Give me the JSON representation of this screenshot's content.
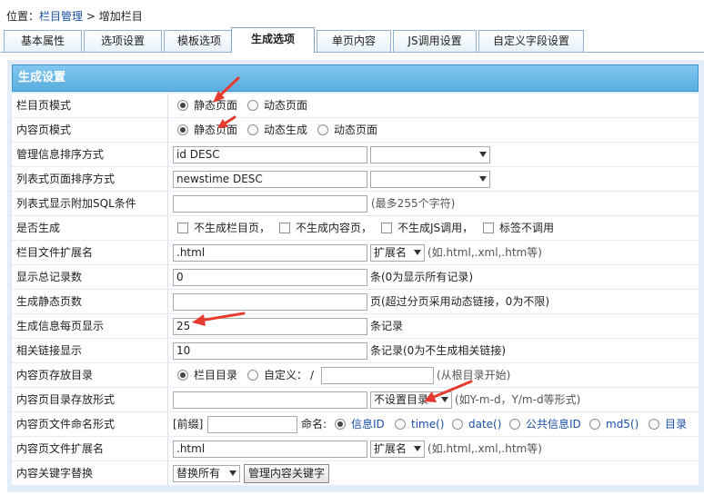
{
  "breadcrumb": {
    "prefix": "位置：",
    "link": "栏目管理",
    "sep": " > ",
    "current": "增加栏目"
  },
  "tabs": [
    "基本属性",
    "选项设置",
    "模板选项",
    "生成选项",
    "单页内容",
    "JS调用设置",
    "自定义字段设置"
  ],
  "active_tab": "生成选项",
  "panel_title": "生成设置",
  "colors": {
    "header": "#5aaede",
    "arrow": "#e53c2f",
    "link": "#1a4fa3"
  },
  "rows": {
    "list_mode": {
      "label": "栏目页模式",
      "opt1": "静态页面",
      "opt2": "动态页面"
    },
    "content_mode": {
      "label": "内容页模式",
      "opt1": "静态页面",
      "opt2": "动态生成",
      "opt3": "动态页面"
    },
    "admin_sort": {
      "label": "管理信息排序方式",
      "value": "id DESC",
      "select": ""
    },
    "list_sort": {
      "label": "列表式页面排序方式",
      "value": "newstime DESC",
      "select": ""
    },
    "list_sql": {
      "label": "列表式显示附加SQL条件",
      "value": "",
      "hint": "(最多255个字符)"
    },
    "gen": {
      "label": "是否生成",
      "c1": "不生成栏目页，",
      "c2": "不生成内容页，",
      "c3": "不生成JS调用，",
      "c4": "标签不调用"
    },
    "list_ext": {
      "label": "栏目文件扩展名",
      "value": ".html",
      "select": "扩展名",
      "hint": "(如.html,.xml,.htm等)"
    },
    "total": {
      "label": "显示总记录数",
      "value": "0",
      "unit": "条(0为显示所有记录)"
    },
    "static_pages": {
      "label": "生成静态页数",
      "value": "",
      "unit": "页(超过分页采用动态链接，0为不限)"
    },
    "per_page": {
      "label": "生成信息每页显示",
      "value": "25",
      "unit": "条记录"
    },
    "related": {
      "label": "相关链接显示",
      "value": "10",
      "unit": "条记录(0为不生成相关链接)"
    },
    "save_dir": {
      "label": "内容页存放目录",
      "opt1": "栏目目录",
      "opt2": "自定义：",
      "slash": "/",
      "value": "",
      "hint": "(从根目录开始)"
    },
    "dir_form": {
      "label": "内容页目录存放形式",
      "value": "",
      "select": "不设置目录",
      "hint": "(如Y-m-d，Y/m-d等形式)"
    },
    "naming": {
      "label": "内容页文件命名形式",
      "prefix": "[前缀]",
      "value": "",
      "name_label": "命名:",
      "o1": "信息ID",
      "o2": "time()",
      "o3": "date()",
      "o4": "公共信息ID",
      "o5": "md5()",
      "o6": "目录"
    },
    "content_ext": {
      "label": "内容页文件扩展名",
      "value": ".html",
      "select": "扩展名",
      "hint": "(如.html,.xml,.htm等)"
    },
    "keyword": {
      "label": "内容关键字替换",
      "select": "替换所有",
      "button": "管理内容关键字"
    }
  }
}
